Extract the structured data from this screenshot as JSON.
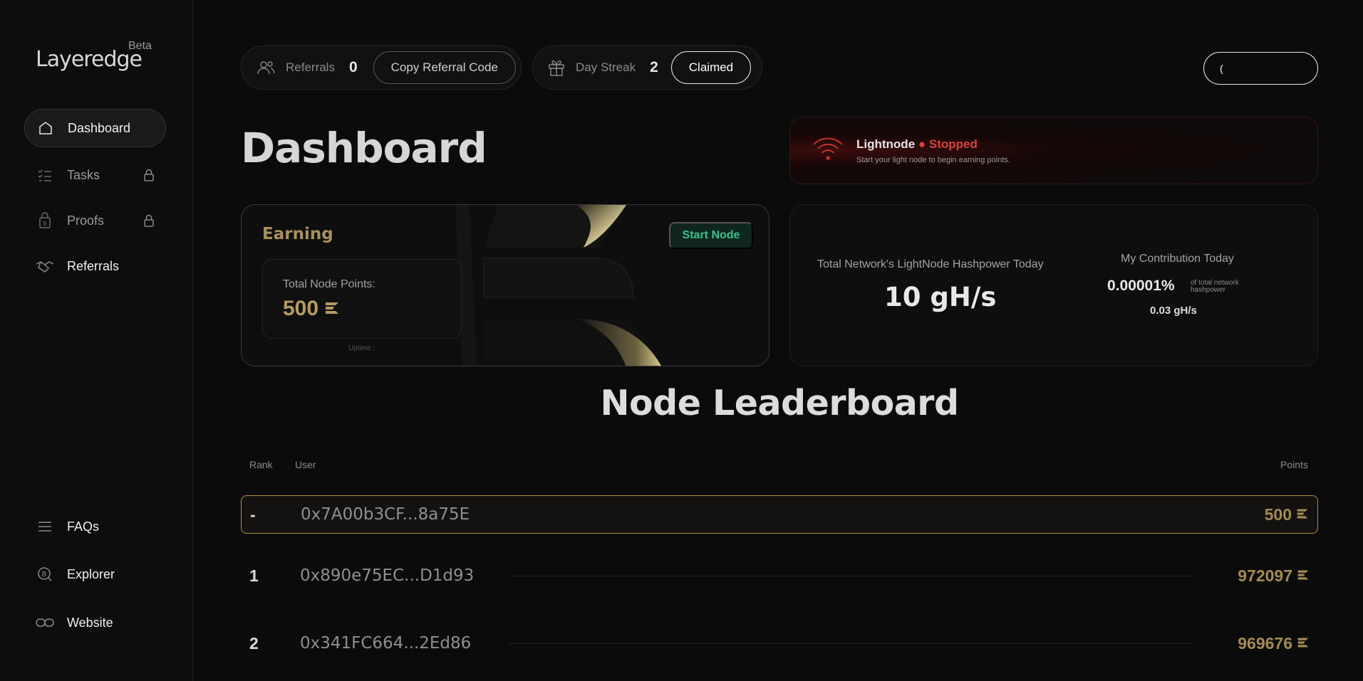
{
  "app": {
    "logo_text": "Layeredge",
    "logo_badge": "Beta"
  },
  "sidebar": {
    "items": [
      {
        "label": "Dashboard",
        "icon": "home-icon",
        "active": true
      },
      {
        "label": "Tasks",
        "icon": "tasks-icon",
        "locked": true
      },
      {
        "label": "Proofs",
        "icon": "proofs-icon",
        "locked": true
      },
      {
        "label": "Referrals",
        "icon": "handshake-icon"
      }
    ],
    "bottom_items": [
      {
        "label": "FAQs",
        "icon": "menu-icon"
      },
      {
        "label": "Explorer",
        "icon": "explorer-icon"
      },
      {
        "label": "Website",
        "icon": "link-icon"
      }
    ]
  },
  "topbar": {
    "referrals_label": "Referrals",
    "referrals_count": "0",
    "copy_referral_label": "Copy Referral Code",
    "streak_label": "Day Streak",
    "streak_count": "2",
    "claimed_label": "Claimed",
    "connect_label": "("
  },
  "page_title": "Dashboard",
  "lightnode": {
    "title": "Lightnode",
    "status": "● Stopped",
    "subtitle": "Start your light node to begin earning points.",
    "status_color": "#d9413d"
  },
  "earning": {
    "title": "Earning",
    "start_button": "Start Node",
    "points_label": "Total Node Points:",
    "points_value": "500",
    "uptime_label": "Uptime :"
  },
  "network": {
    "hashpower_label": "Total Network's LightNode Hashpower Today",
    "hashpower_value": "10 gH/s",
    "contribution_label": "My Contribution Today",
    "contribution_pct": "0.00001%",
    "contribution_note": "of total network hashpower",
    "contribution_ghs": "0.03 gH/s"
  },
  "leaderboard": {
    "title": "Node Leaderboard",
    "columns": {
      "rank": "Rank",
      "user": "User",
      "points": "Points"
    },
    "rows": [
      {
        "rank": "-",
        "user": "0x7A00b3CF...8a75E",
        "points": "500",
        "is_me": true
      },
      {
        "rank": "1",
        "user": "0x890e75EC...D1d93",
        "points": "972097"
      },
      {
        "rank": "2",
        "user": "0x341FC664...2Ed86",
        "points": "969676"
      }
    ]
  },
  "colors": {
    "accent_gold": "#b59a62",
    "start_green": "#3fbf8a",
    "stopped_red": "#d9413d"
  }
}
